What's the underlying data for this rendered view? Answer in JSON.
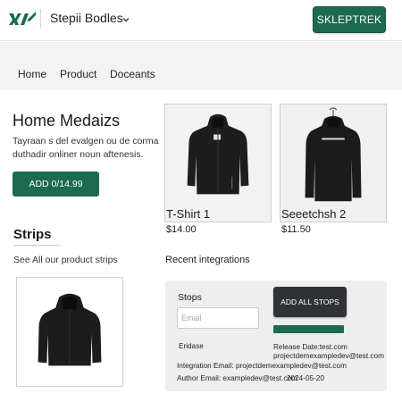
{
  "header": {
    "store_name": "Stepii Bodles",
    "primary_action": "SKLEPTREK"
  },
  "nav": {
    "items": [
      "Home",
      "Product",
      "Doceants"
    ]
  },
  "hero": {
    "title": "Home Medaizs",
    "description": "Tayraan s del evalgen ou de corma duthadir onliner noun aftenesis.",
    "button_label": "ADD 0/14.99"
  },
  "products": [
    {
      "name": "T-Shirt 1",
      "price": "$14.00"
    },
    {
      "name": "Seeetchsh 2",
      "price": "$11.50"
    }
  ],
  "strips": {
    "title": "Strips",
    "subtitle": "See All our product strips"
  },
  "integrations": {
    "title": "Recent integrations",
    "panel_title": "Stops",
    "email_placeholder": "Email",
    "add_all_label": "ADD ALL STOPS",
    "release_label": "Eridase",
    "release_date": "Release Date:test.com",
    "release_email": "projectdemexampledev@test.com",
    "integration_email": "Integration Email: projectdemexampledev@test.com",
    "author_email": "Author Email: exampledev@test.com",
    "author_date": "2024-05-20"
  },
  "colors": {
    "accent": "#1c6b50",
    "dark_button": "#2f3337",
    "nav_background": "#f3f3f3"
  }
}
